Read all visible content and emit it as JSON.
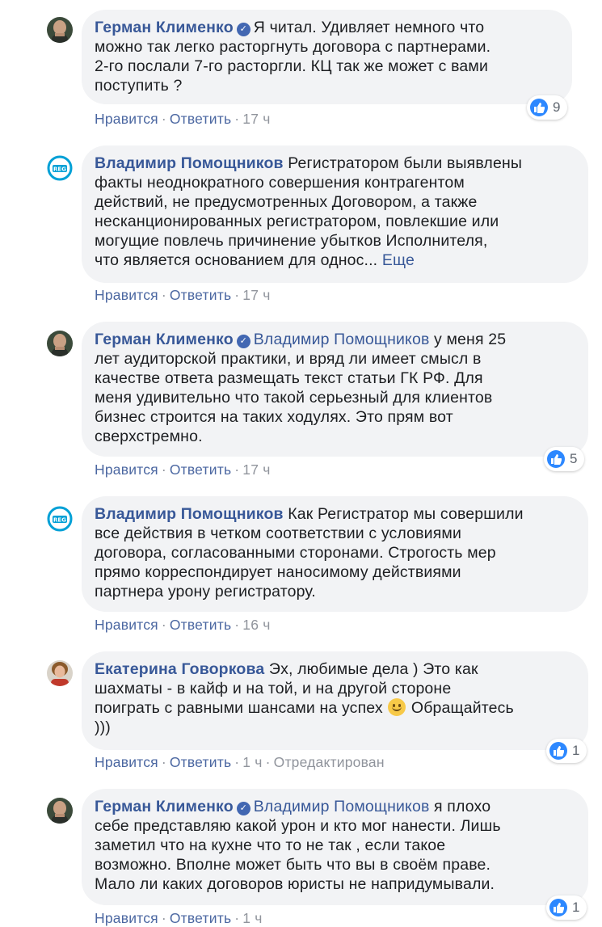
{
  "icons": {
    "verified": "verified-checkmark-icon",
    "like": "thumbs-up-icon",
    "emoji": "smile-emoji-icon",
    "reg_logo": "reg-logo-icon"
  },
  "colors": {
    "author": "#385898",
    "bubble": "#f2f3f5",
    "meta": "#90949c",
    "like": "#2d88ff"
  },
  "comments": [
    {
      "author": "Герман Клименко",
      "verified": true,
      "line1": "Я читал. Удивляет немного что",
      "text": [
        "можно так легко расторгнуть договора с партнерами.",
        "2-го послали 7-го расторгли. КЦ так же может с вами",
        "поступить ?"
      ],
      "like": "Нравится",
      "reply": "Ответить",
      "time": "17 ч",
      "reactions": "9"
    },
    {
      "author": "Владимир Помощников",
      "line1": "Регистратором были выявлены",
      "text": [
        "факты неоднократного совершения контрагентом",
        "действий, не предусмотренных Договором, а также",
        "несканционированных регистратором, повлекшие или",
        "могущие повлечь причинение убытков Исполнителя,"
      ],
      "last_line": "что является основанием для однос...",
      "more": "Еще",
      "like": "Нравится",
      "reply": "Ответить",
      "time": "17 ч"
    },
    {
      "author": "Герман Клименко",
      "verified": true,
      "mention": "Владимир Помощников",
      "line1": "у меня 25",
      "text": [
        "лет аудиторской практики, и вряд ли имеет смысл в",
        "качестве ответа размещать текст статьи ГК РФ. Для",
        "меня удивительно что такой серьезный для клиентов",
        "бизнес строится на таких ходулях. Это прям вот",
        "сверхстремно."
      ],
      "like": "Нравится",
      "reply": "Ответить",
      "time": "17 ч",
      "reactions": "5"
    },
    {
      "author": "Владимир Помощников",
      "line1": "Как Регистратор мы совершили",
      "text": [
        "все действия в четком соответствии с условиями",
        "договора, согласованными сторонами. Строгость мер",
        "прямо корреспондирует наносимому действиями",
        "партнера урону регистратору."
      ],
      "like": "Нравится",
      "reply": "Ответить",
      "time": "16 ч"
    },
    {
      "author": "Екатерина Говоркова",
      "line1": "Эх, любимые дела ) Это как",
      "text": [
        "шахматы - в кайф и на той, и на другой стороне"
      ],
      "line3_before": "поиграть с равными шансами на успех",
      "line3_after": "Обращайтесь",
      "line4": ")))",
      "like": "Нравится",
      "reply": "Ответить",
      "time": "1 ч",
      "edited": "Отредактирован",
      "reactions": "1"
    },
    {
      "author": "Герман Клименко",
      "verified": true,
      "mention": "Владимир Помощников",
      "line1": "я плохо",
      "text": [
        "себе представляю какой урон и кто мог нанести. Лишь",
        "заметил что на кухне что то не так , если такое",
        "возможно. Вполне может быть что вы в своём праве.",
        "Мало ли каких договоров юристы не напридумывали."
      ],
      "like": "Нравится",
      "reply": "Ответить",
      "time": "1 ч",
      "reactions": "1"
    }
  ]
}
